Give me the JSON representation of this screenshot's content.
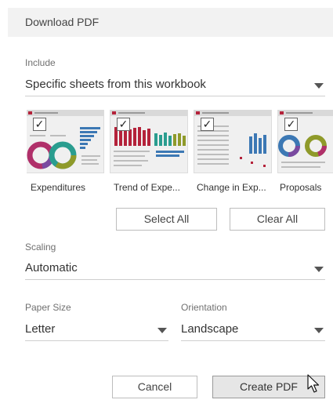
{
  "dialog": {
    "title": "Download PDF"
  },
  "include": {
    "label": "Include",
    "selected": "Specific sheets from this workbook"
  },
  "sheets": [
    {
      "name": "Expenditures",
      "checked": true,
      "check_glyph": "✓",
      "preview": "donut-dashboard"
    },
    {
      "name": "Trend of Expe...",
      "checked": true,
      "check_glyph": "✓",
      "preview": "bar-trend-dashboard"
    },
    {
      "name": "Change in Exp...",
      "checked": true,
      "check_glyph": "✓",
      "preview": "table-bars-dashboard"
    },
    {
      "name": "Proposals",
      "checked": true,
      "check_glyph": "✓",
      "preview": "donut-dashboard"
    }
  ],
  "buttons": {
    "select_all": "Select All",
    "clear_all": "Clear All",
    "cancel": "Cancel",
    "create_pdf": "Create PDF"
  },
  "scaling": {
    "label": "Scaling",
    "selected": "Automatic"
  },
  "paper_size": {
    "label": "Paper Size",
    "selected": "Letter"
  },
  "orientation": {
    "label": "Orientation",
    "selected": "Landscape"
  },
  "colors": {
    "accent_red": "#b4223a",
    "teal": "#2a9d8f",
    "blue": "#3c78b4",
    "olive": "#8f9a2a",
    "magenta": "#b0306a"
  }
}
